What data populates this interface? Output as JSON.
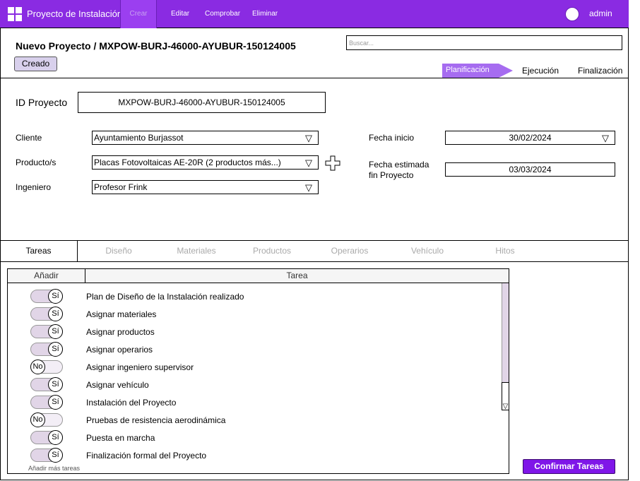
{
  "header": {
    "app_title": "Proyecto de Instalación",
    "menu": [
      "Crear",
      "Editar",
      "Comprobar",
      "Eliminar"
    ],
    "user": "admin",
    "colors": {
      "brand": "#8a2be2",
      "accent": "#7f16e8"
    }
  },
  "project": {
    "title": "Nuevo Proyecto / MXPOW-BURJ-46000-AYUBUR-150124005",
    "status": "Creado"
  },
  "search": {
    "placeholder": "Buscar..."
  },
  "steps": [
    "Planificación",
    "Ejecución",
    "Finalización"
  ],
  "form": {
    "id_label": "ID Proyecto",
    "id_value": "MXPOW-BURJ-46000-AYUBUR-150124005",
    "cliente_label": "Cliente",
    "cliente_value": "Ayuntamiento Burjassot",
    "producto_label": "Producto/s",
    "producto_value": "Placas Fotovoltaicas AE-20R (2 productos más...)",
    "ingeniero_label": "Ingeniero",
    "ingeniero_value": "Profesor Frink",
    "fecha_inicio_label": "Fecha inicio",
    "fecha_inicio_value": "30/02/2024",
    "fecha_fin_label_1": "Fecha estimada",
    "fecha_fin_label_2": "fin Proyecto",
    "fecha_fin_value": "03/03/2024"
  },
  "tabs": [
    "Tareas",
    "Diseño",
    "Materiales",
    "Productos",
    "Operarios",
    "Vehículo",
    "Hitos"
  ],
  "table": {
    "col_add": "Añadir",
    "col_task": "Tarea",
    "rows": [
      {
        "toggle": "Sí",
        "task": "Plan de Diseño de la Instalación realizado"
      },
      {
        "toggle": "Sí",
        "task": "Asignar materiales"
      },
      {
        "toggle": "Sí",
        "task": "Asignar productos"
      },
      {
        "toggle": "Sí",
        "task": "Asignar operarios"
      },
      {
        "toggle": "No",
        "task": "Asignar ingeniero supervisor"
      },
      {
        "toggle": "Sí",
        "task": "Asignar vehículo"
      },
      {
        "toggle": "Sí",
        "task": "Instalación del Proyecto"
      },
      {
        "toggle": "No",
        "task": "Pruebas de resistencia aerodinámica"
      },
      {
        "toggle": "Sí",
        "task": "Puesta en marcha"
      },
      {
        "toggle": "Sí",
        "task": "Finalización formal del Proyecto"
      }
    ],
    "add_more": "Añadir más tareas"
  },
  "actions": {
    "confirm": "Confirmar Tareas"
  }
}
